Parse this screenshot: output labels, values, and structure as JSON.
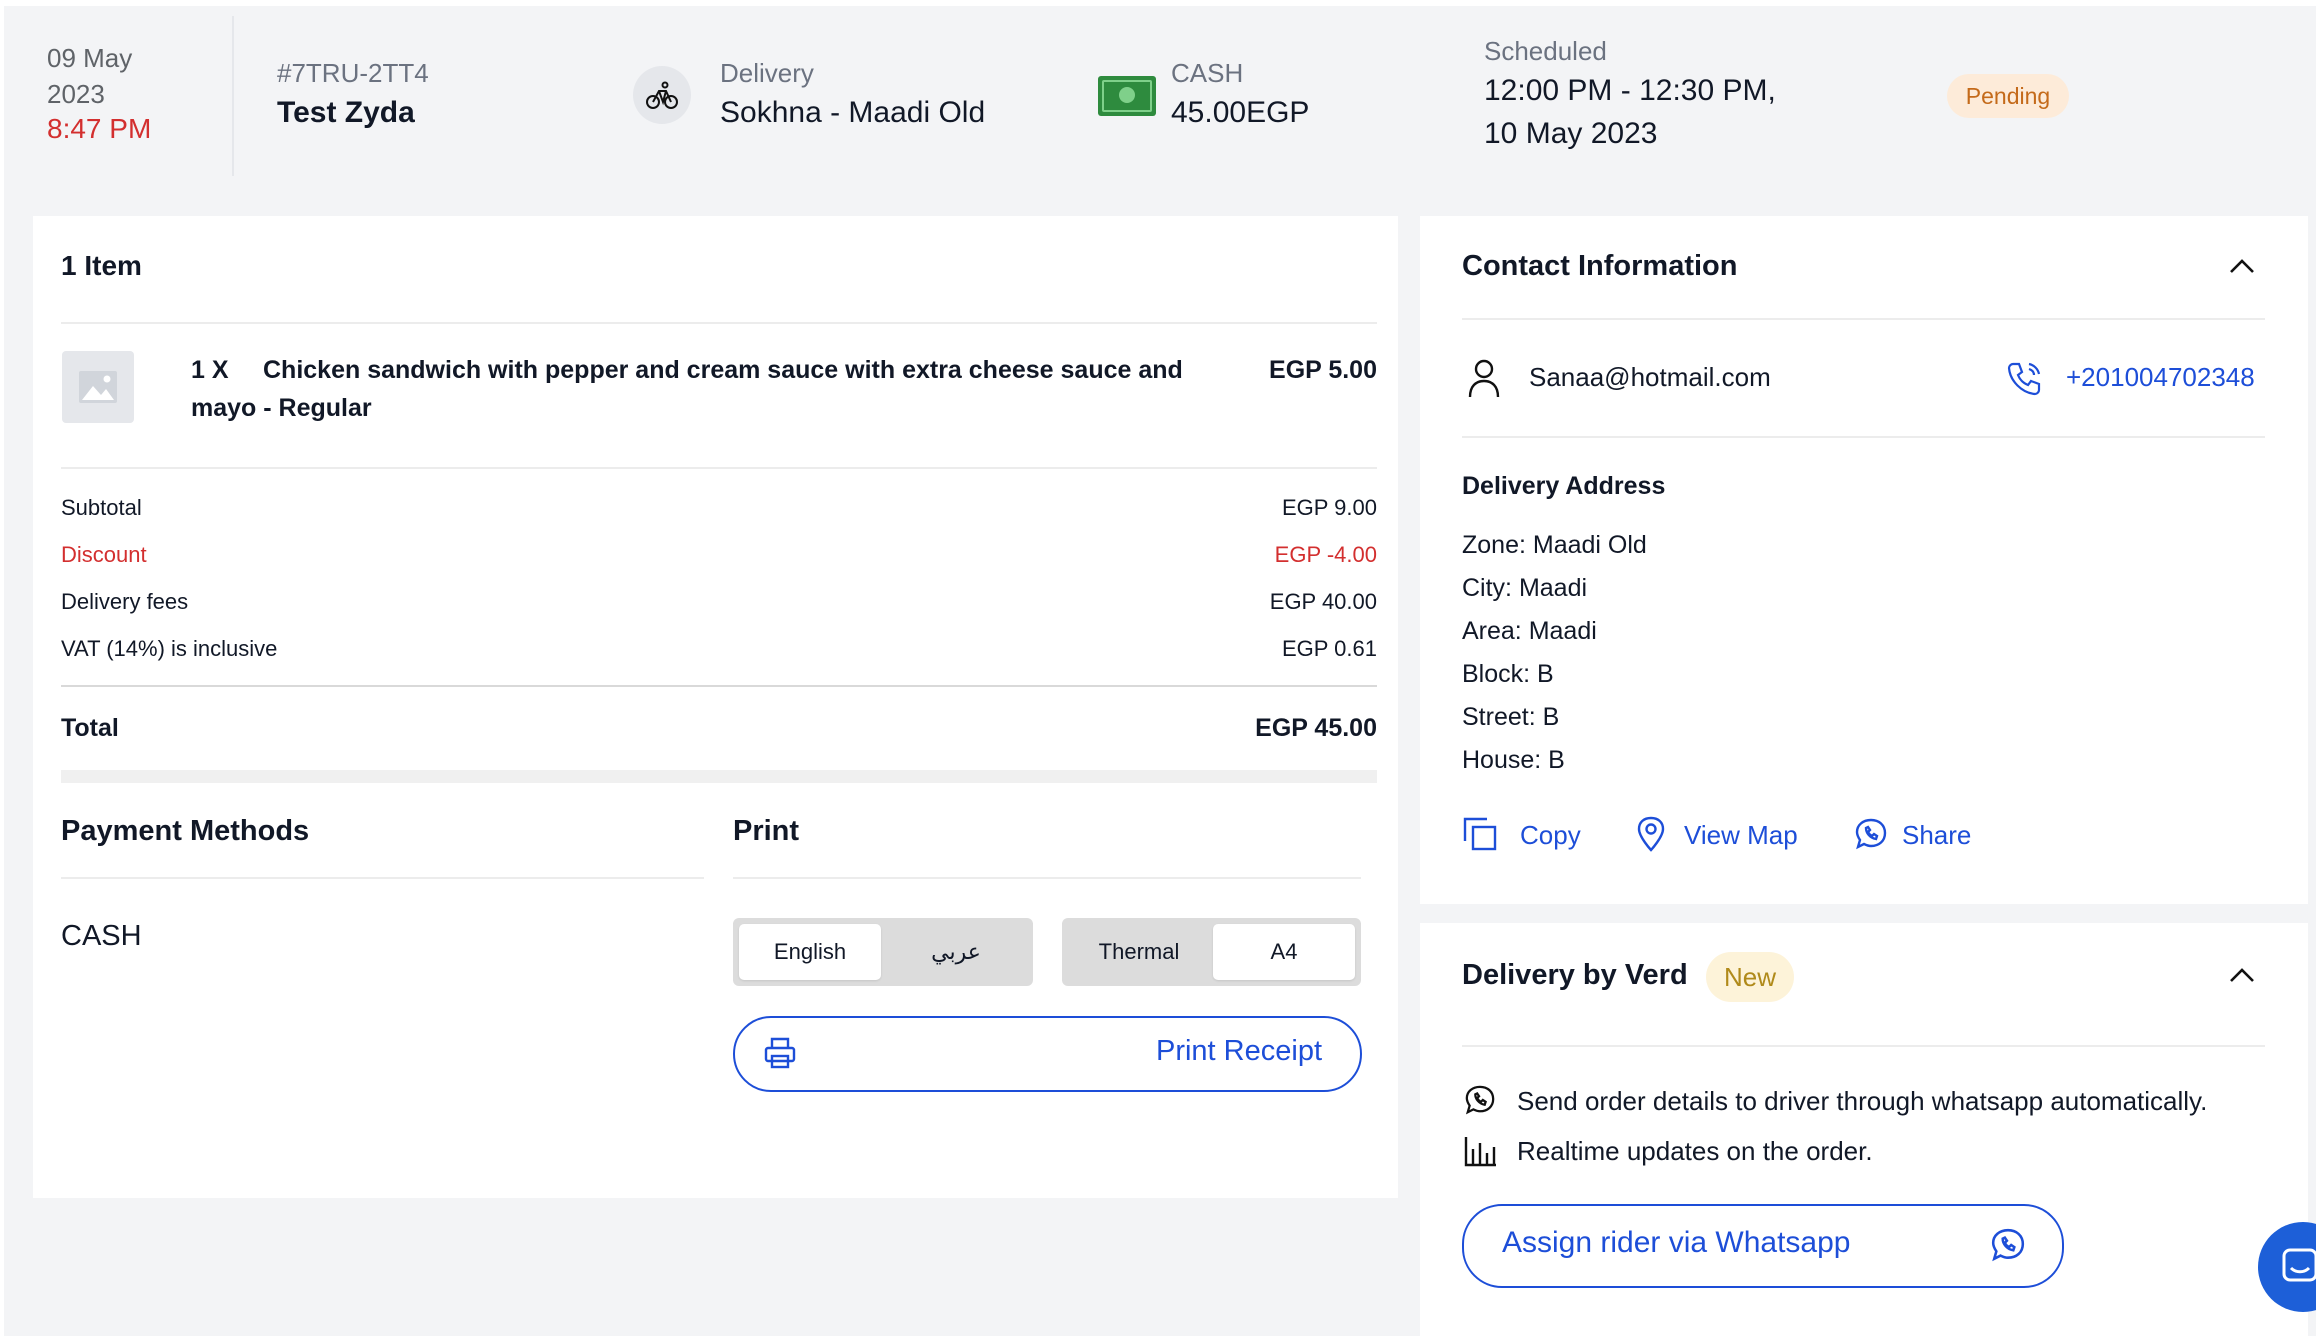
{
  "header": {
    "date_line1": "09 May",
    "date_line2": "2023",
    "time": "8:47 PM",
    "order_id": "#7TRU-2TT4",
    "customer": "Test Zyda",
    "delivery_label": "Delivery",
    "branch": "Sokhna - Maadi Old",
    "payment_label": "CASH",
    "amount": "45.00EGP",
    "scheduled_label": "Scheduled",
    "scheduled_line1": "12:00 PM - 12:30 PM,",
    "scheduled_line2": "10 May 2023",
    "status": "Pending",
    "icons": {
      "delivery": "bicycle-icon",
      "payment": "cash-icon"
    }
  },
  "items": {
    "title": "1 Item",
    "list": [
      {
        "qty": "1 X",
        "name_line1": "Chicken sandwich with pepper and cream sauce with extra cheese sauce and",
        "name_line2": "mayo - Regular",
        "price": "EGP 5.00"
      }
    ]
  },
  "summary": {
    "subtotal_label": "Subtotal",
    "subtotal": "EGP 9.00",
    "discount_label": "Discount",
    "discount": "EGP -4.00",
    "delivery_label": "Delivery fees",
    "delivery": "EGP 40.00",
    "vat_label": "VAT (14%) is inclusive",
    "vat": "EGP 0.61",
    "total_label": "Total",
    "total": "EGP 45.00"
  },
  "payment": {
    "title": "Payment Methods",
    "method": "CASH"
  },
  "print": {
    "title": "Print",
    "language_options": [
      "English",
      "عربي"
    ],
    "language_selected": "English",
    "format_options": [
      "Thermal",
      "A4"
    ],
    "format_selected": "A4",
    "button": "Print Receipt"
  },
  "contact": {
    "title": "Contact Information",
    "email": "Sanaa@hotmail.com",
    "phone": "+201004702348",
    "address_title": "Delivery Address",
    "address": [
      "Zone: Maadi Old",
      "City: Maadi",
      "Area: Maadi",
      "Block: B",
      "Street: B",
      "House: B"
    ],
    "actions": {
      "copy": "Copy",
      "view_map": "View Map",
      "share": "Share"
    }
  },
  "verd": {
    "title": "Delivery by Verd",
    "badge": "New",
    "feature1": "Send order details to driver through whatsapp automatically.",
    "feature2": "Realtime updates on the order.",
    "button": "Assign rider via Whatsapp"
  },
  "colors": {
    "accent": "#1d4ed8",
    "danger": "#d32f2f",
    "pending_bg": "#fdebd9",
    "pending_text": "#c46a1a",
    "page_bg": "#f3f4f6"
  }
}
